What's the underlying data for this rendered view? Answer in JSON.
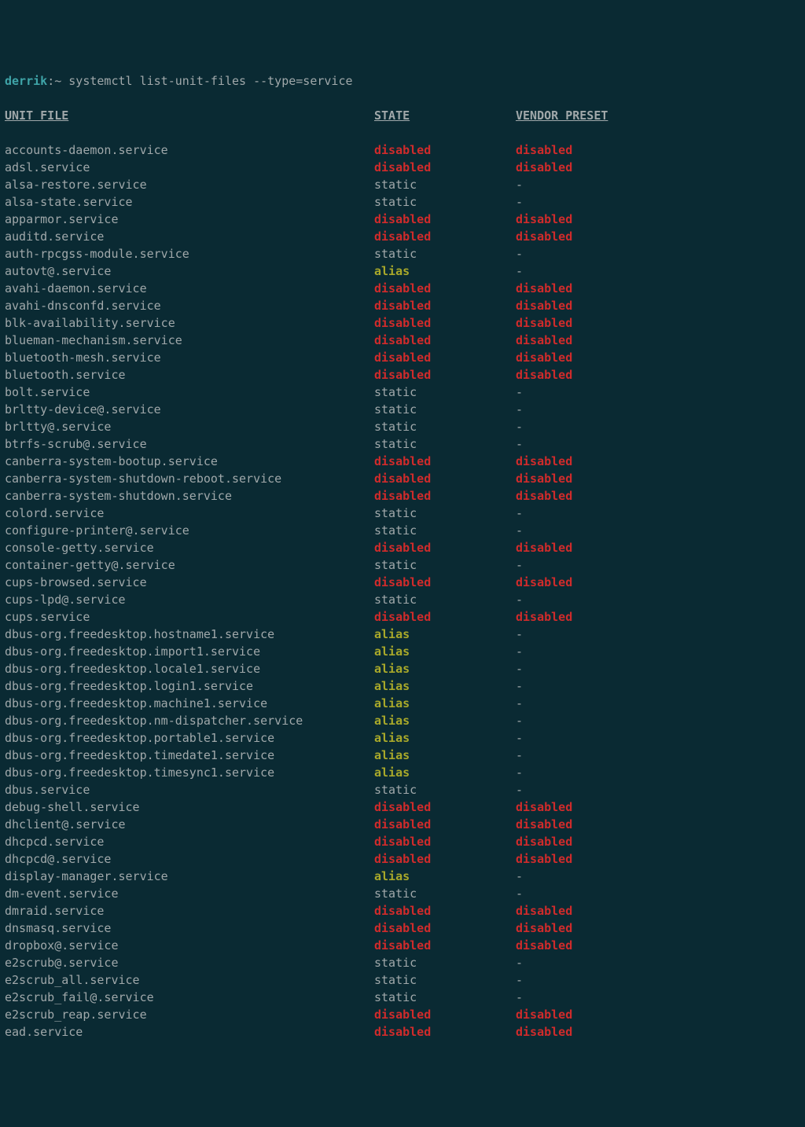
{
  "prompt": {
    "user": "derrik",
    "sep": ":",
    "path": "~ ",
    "command": "systemctl list-unit-files --type=service"
  },
  "headers": {
    "unit": "UNIT FILE",
    "state": "STATE",
    "preset": "VENDOR PRESET"
  },
  "rows": [
    {
      "unit": "accounts-daemon.service",
      "state": "disabled",
      "preset": "disabled"
    },
    {
      "unit": "adsl.service",
      "state": "disabled",
      "preset": "disabled"
    },
    {
      "unit": "alsa-restore.service",
      "state": "static",
      "preset": "-"
    },
    {
      "unit": "alsa-state.service",
      "state": "static",
      "preset": "-"
    },
    {
      "unit": "apparmor.service",
      "state": "disabled",
      "preset": "disabled"
    },
    {
      "unit": "auditd.service",
      "state": "disabled",
      "preset": "disabled"
    },
    {
      "unit": "auth-rpcgss-module.service",
      "state": "static",
      "preset": "-"
    },
    {
      "unit": "autovt@.service",
      "state": "alias",
      "preset": "-"
    },
    {
      "unit": "avahi-daemon.service",
      "state": "disabled",
      "preset": "disabled"
    },
    {
      "unit": "avahi-dnsconfd.service",
      "state": "disabled",
      "preset": "disabled"
    },
    {
      "unit": "blk-availability.service",
      "state": "disabled",
      "preset": "disabled"
    },
    {
      "unit": "blueman-mechanism.service",
      "state": "disabled",
      "preset": "disabled"
    },
    {
      "unit": "bluetooth-mesh.service",
      "state": "disabled",
      "preset": "disabled"
    },
    {
      "unit": "bluetooth.service",
      "state": "disabled",
      "preset": "disabled"
    },
    {
      "unit": "bolt.service",
      "state": "static",
      "preset": "-"
    },
    {
      "unit": "brltty-device@.service",
      "state": "static",
      "preset": "-"
    },
    {
      "unit": "brltty@.service",
      "state": "static",
      "preset": "-"
    },
    {
      "unit": "btrfs-scrub@.service",
      "state": "static",
      "preset": "-"
    },
    {
      "unit": "canberra-system-bootup.service",
      "state": "disabled",
      "preset": "disabled"
    },
    {
      "unit": "canberra-system-shutdown-reboot.service",
      "state": "disabled",
      "preset": "disabled"
    },
    {
      "unit": "canberra-system-shutdown.service",
      "state": "disabled",
      "preset": "disabled"
    },
    {
      "unit": "colord.service",
      "state": "static",
      "preset": "-"
    },
    {
      "unit": "configure-printer@.service",
      "state": "static",
      "preset": "-"
    },
    {
      "unit": "console-getty.service",
      "state": "disabled",
      "preset": "disabled"
    },
    {
      "unit": "container-getty@.service",
      "state": "static",
      "preset": "-"
    },
    {
      "unit": "cups-browsed.service",
      "state": "disabled",
      "preset": "disabled"
    },
    {
      "unit": "cups-lpd@.service",
      "state": "static",
      "preset": "-"
    },
    {
      "unit": "cups.service",
      "state": "disabled",
      "preset": "disabled"
    },
    {
      "unit": "dbus-org.freedesktop.hostname1.service",
      "state": "alias",
      "preset": "-"
    },
    {
      "unit": "dbus-org.freedesktop.import1.service",
      "state": "alias",
      "preset": "-"
    },
    {
      "unit": "dbus-org.freedesktop.locale1.service",
      "state": "alias",
      "preset": "-"
    },
    {
      "unit": "dbus-org.freedesktop.login1.service",
      "state": "alias",
      "preset": "-"
    },
    {
      "unit": "dbus-org.freedesktop.machine1.service",
      "state": "alias",
      "preset": "-"
    },
    {
      "unit": "dbus-org.freedesktop.nm-dispatcher.service",
      "state": "alias",
      "preset": "-"
    },
    {
      "unit": "dbus-org.freedesktop.portable1.service",
      "state": "alias",
      "preset": "-"
    },
    {
      "unit": "dbus-org.freedesktop.timedate1.service",
      "state": "alias",
      "preset": "-"
    },
    {
      "unit": "dbus-org.freedesktop.timesync1.service",
      "state": "alias",
      "preset": "-"
    },
    {
      "unit": "dbus.service",
      "state": "static",
      "preset": "-"
    },
    {
      "unit": "debug-shell.service",
      "state": "disabled",
      "preset": "disabled"
    },
    {
      "unit": "dhclient@.service",
      "state": "disabled",
      "preset": "disabled"
    },
    {
      "unit": "dhcpcd.service",
      "state": "disabled",
      "preset": "disabled"
    },
    {
      "unit": "dhcpcd@.service",
      "state": "disabled",
      "preset": "disabled"
    },
    {
      "unit": "display-manager.service",
      "state": "alias",
      "preset": "-"
    },
    {
      "unit": "dm-event.service",
      "state": "static",
      "preset": "-"
    },
    {
      "unit": "dmraid.service",
      "state": "disabled",
      "preset": "disabled"
    },
    {
      "unit": "dnsmasq.service",
      "state": "disabled",
      "preset": "disabled"
    },
    {
      "unit": "dropbox@.service",
      "state": "disabled",
      "preset": "disabled"
    },
    {
      "unit": "e2scrub@.service",
      "state": "static",
      "preset": "-"
    },
    {
      "unit": "e2scrub_all.service",
      "state": "static",
      "preset": "-"
    },
    {
      "unit": "e2scrub_fail@.service",
      "state": "static",
      "preset": "-"
    },
    {
      "unit": "e2scrub_reap.service",
      "state": "disabled",
      "preset": "disabled"
    },
    {
      "unit": "ead.service",
      "state": "disabled",
      "preset": "disabled"
    }
  ]
}
